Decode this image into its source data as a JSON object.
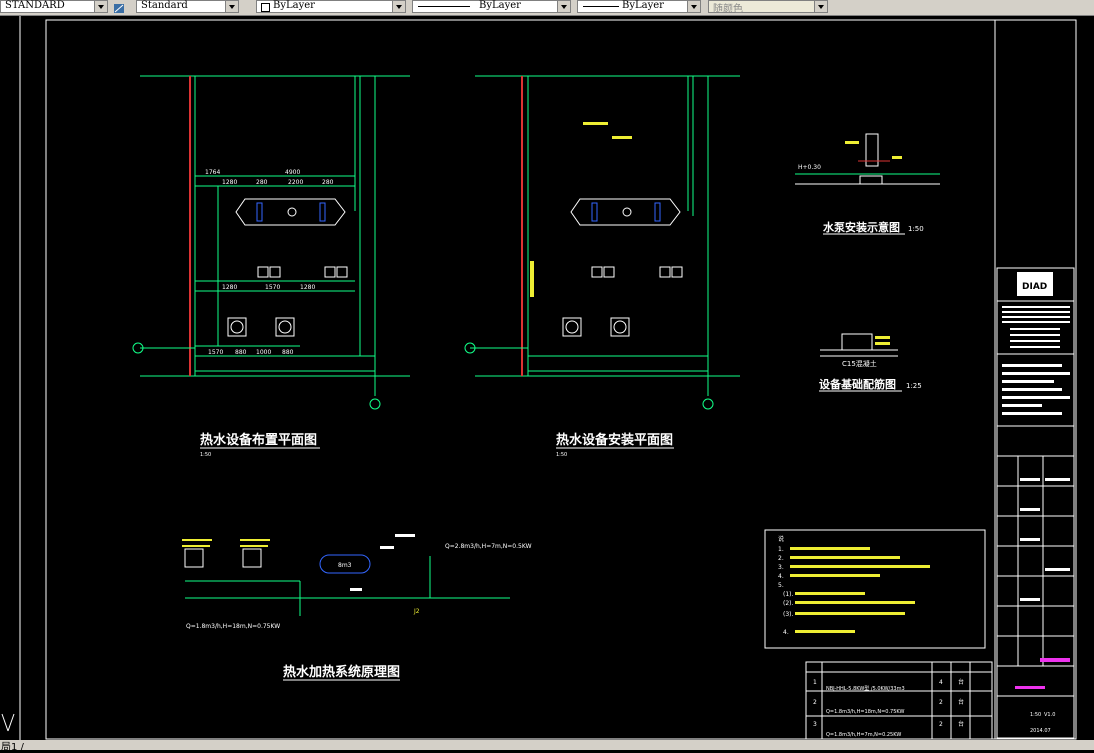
{
  "toolbar": {
    "text_style": "STANDARD",
    "dim_style": "Standard",
    "layer": "ByLayer",
    "linetype": "ByLayer",
    "lineweight": "ByLayer",
    "color": "随颜色"
  },
  "drawing": {
    "plan1": {
      "title": "热水设备布置平面图",
      "scale": "1:50",
      "dims_top": [
        "1764",
        "4900"
      ],
      "dims_row": [
        "1280",
        "280",
        "2200",
        "280"
      ],
      "dims_mid": [
        "1280",
        "1570",
        "1280"
      ],
      "dims_bot": [
        "1570",
        "880",
        "1000",
        "880"
      ]
    },
    "plan2": {
      "title": "热水设备安装平面图",
      "scale": "1:50"
    },
    "pump_detail": {
      "title": "水泵安装示意图",
      "scale": "1:50",
      "label": "H+0.30"
    },
    "foundation_detail": {
      "title": "设备基础配筋图",
      "scale": "1:25",
      "label": "C15混凝土"
    },
    "system": {
      "title": "热水加热系统原理图",
      "heater_label_1": "Q=1.8m3/h,H=18m,N=0.75KW",
      "heater_label_2": "Q=2.8m3/h,H=7m,N=0.5KW",
      "tank_label": "8m3",
      "pipe_label": "J2"
    },
    "notes": {
      "title": "说",
      "lines": [
        "1.",
        "2.",
        "3.",
        "4.",
        "5.",
        "(1).",
        "(2).",
        "(3).",
        "4."
      ]
    },
    "equip_table": {
      "rows": [
        {
          "no": "1",
          "desc": "NBJ-HHL-5.8KW型 /5.0KW/33m3",
          "qty": "4",
          "unit": "台"
        },
        {
          "no": "2",
          "desc": "Q=1.8m3/h,H=18m,N=0.75KW",
          "qty": "2",
          "unit": "台"
        },
        {
          "no": "3",
          "desc": "Q=1.8m3/h,H=7m,N=0.25KW",
          "qty": "2",
          "unit": "台"
        }
      ]
    },
    "title_block": {
      "logo": "DIAD",
      "scale": "1:50",
      "version": "V1.0",
      "date": "2014.07"
    }
  },
  "statusbar": {
    "text": "局1 /"
  }
}
